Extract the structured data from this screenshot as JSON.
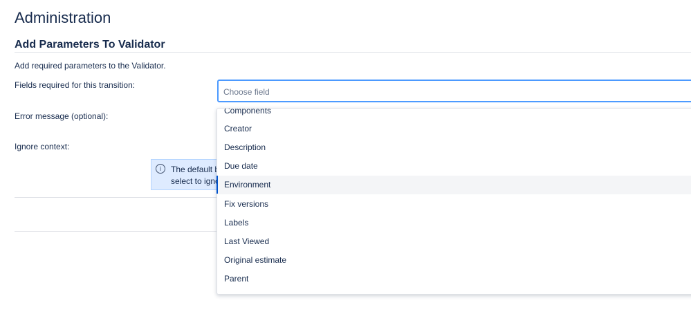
{
  "header": {
    "title": "Administration",
    "subtitle": "Add Parameters To Validator"
  },
  "form": {
    "description": "Add required parameters to the Validator.",
    "fields_label": "Fields required for this transition:",
    "fields_placeholder": "Choose field",
    "error_label": "Error message (optional):",
    "ignore_label": "Ignore context:",
    "info_line1": "The default b",
    "info_line2": "select to igno"
  },
  "dropdown": {
    "highlighted": "Environment",
    "items": [
      "Components",
      "Creator",
      "Description",
      "Due date",
      "Environment",
      "Fix versions",
      "Labels",
      "Last Viewed",
      "Original estimate",
      "Parent"
    ]
  }
}
